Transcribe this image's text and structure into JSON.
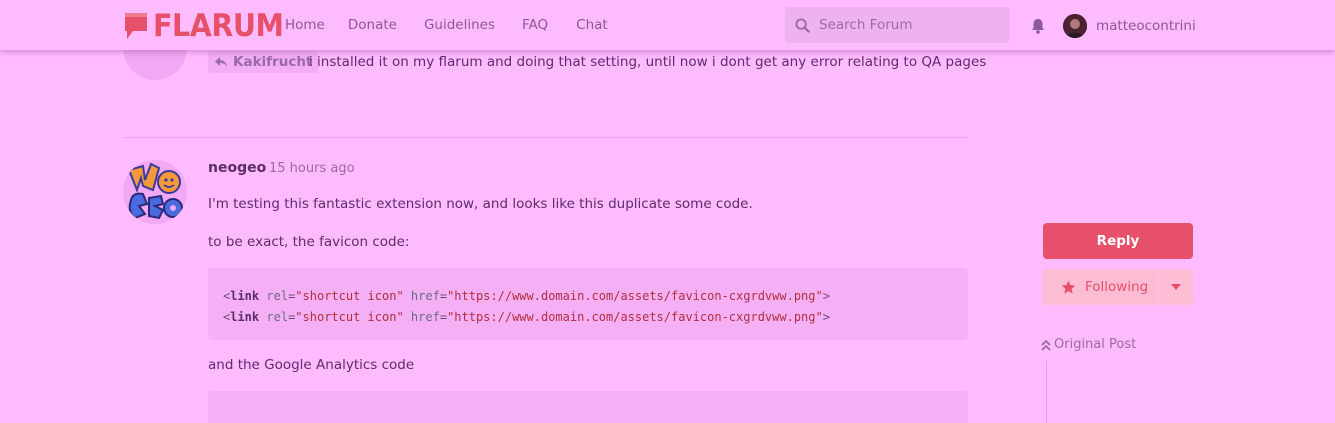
{
  "header": {
    "logo_text": "FLARUM",
    "nav": [
      "Home",
      "Donate",
      "Guidelines",
      "FAQ",
      "Chat"
    ],
    "search_placeholder": "Search Forum",
    "username": "matteocontrini"
  },
  "previous_post": {
    "mention": "Kakifrucht",
    "text": "i installed it on my flarum and doing that setting, until now i dont get any error relating to QA pages"
  },
  "post": {
    "username": "neogeo",
    "time": "15 hours ago",
    "p1": "I'm testing this fantastic extension now, and looks like this duplicate some code.",
    "p2": "to be exact, the favicon code:",
    "code_lines": [
      {
        "tag": "link",
        "attr1": "rel",
        "val1": "\"shortcut icon\"",
        "attr2": "href",
        "val2": "\"https://www.domain.com/assets/favicon-cxgrdvww.png\""
      },
      {
        "tag": "link",
        "attr1": "rel",
        "val1": "\"shortcut icon\"",
        "attr2": "href",
        "val2": "\"https://www.domain.com/assets/favicon-cxgrdvww.png\""
      }
    ],
    "p3": "and the Google Analytics code"
  },
  "sidebar": {
    "reply_label": "Reply",
    "following_label": "Following",
    "original_post_label": "Original Post"
  },
  "colors": {
    "background": "#ffbbff",
    "accent": "#e7506a",
    "text": "#5c2c6b",
    "muted": "#9a6aa8"
  }
}
